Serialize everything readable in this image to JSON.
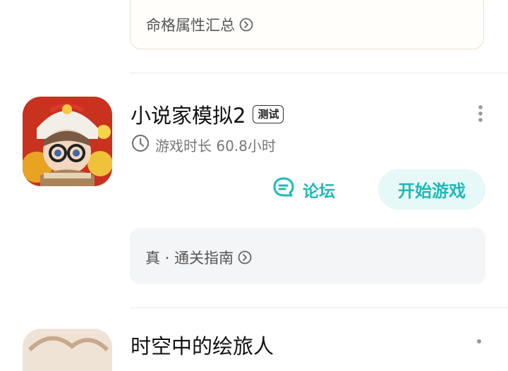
{
  "prev_card": {
    "label": "命格属性汇总"
  },
  "game": {
    "title": "小说家模拟2",
    "badge": "测试",
    "playtime_label": "游戏时长 60.8小时",
    "forum_label": "论坛",
    "start_label": "开始游戏",
    "guide_label": "真 · 通关指南"
  },
  "next_game": {
    "title": "时空中的绘旅人"
  },
  "colors": {
    "accent": "#1fb9b6",
    "accent_bg": "#e6f8f7",
    "card_bg": "#f4f5f7"
  }
}
